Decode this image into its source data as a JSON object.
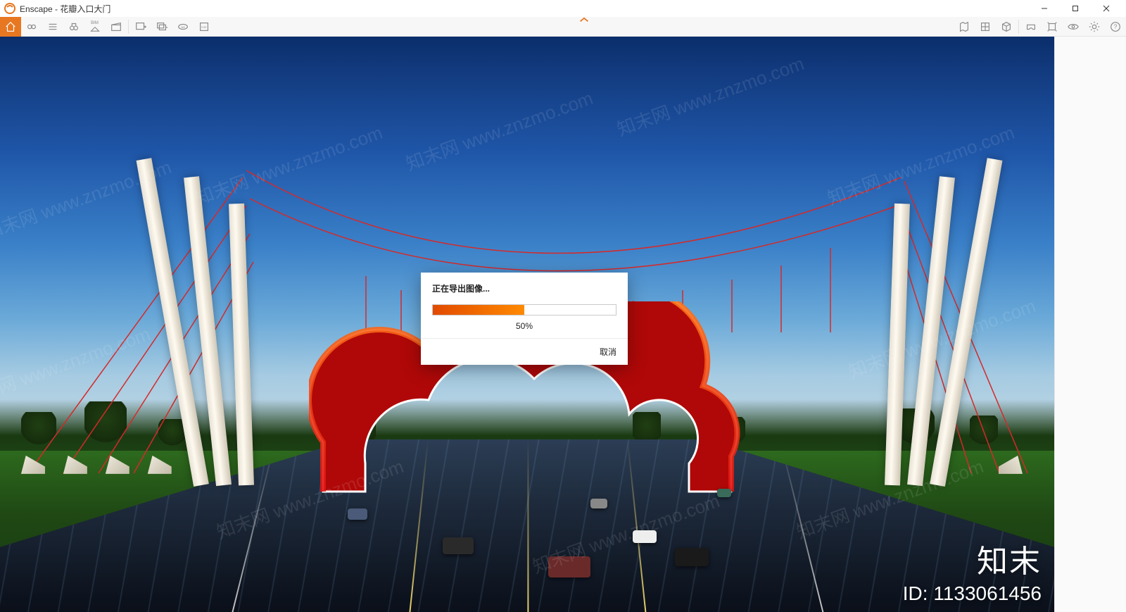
{
  "app": {
    "name": "Enscape",
    "title_separator": " - ",
    "document": "花瓣入口大门"
  },
  "window_controls": {
    "minimize": "—",
    "maximize": "❐",
    "close": "✕"
  },
  "toolbar": {
    "left_icons": [
      "home-icon",
      "link-icon",
      "menu-icon",
      "binoculars-icon",
      "compass-icon",
      "clapperboard-icon",
      "image-export-icon",
      "batch-export-icon",
      "pano360-icon",
      "exe-export-icon"
    ],
    "bim_label": "BIM",
    "right_icons": [
      "map-icon",
      "asset-library-icon",
      "cube-icon",
      "sep",
      "vr-icon",
      "depth-icon",
      "view-icon",
      "settings-icon",
      "help-icon"
    ]
  },
  "dialog": {
    "title": "正在导出图像...",
    "progress_percent": 50,
    "progress_text": "50%",
    "cancel_label": "取消"
  },
  "watermark": {
    "repeat_text": "知末网 www.znzmo.com",
    "logo_text": "知末",
    "id_prefix": "ID: ",
    "id_value": "1133061456"
  },
  "colors": {
    "accent": "#e87722",
    "progress_start": "#e24a00",
    "progress_end": "#ff8a00"
  }
}
